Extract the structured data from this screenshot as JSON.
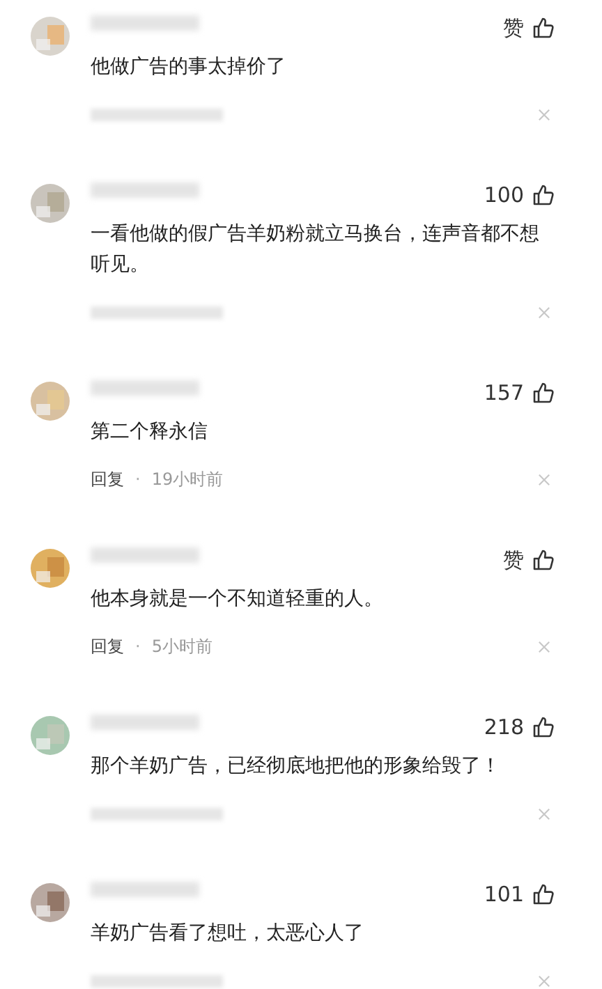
{
  "comments": [
    {
      "likes": "赞",
      "text": "他做广告的事太掉价了",
      "meta_hidden": true
    },
    {
      "likes": "100",
      "text": "一看他做的假广告羊奶粉就立马换台，连声音都不想听见。",
      "meta_hidden": true
    },
    {
      "likes": "157",
      "text": "第二个释永信",
      "meta_hidden": false,
      "reply": "回复",
      "separator": "·",
      "time": "19小时前"
    },
    {
      "likes": "赞",
      "text": "他本身就是一个不知道轻重的人。",
      "meta_hidden": false,
      "reply": "回复",
      "separator": "·",
      "time": "5小时前"
    },
    {
      "likes": "218",
      "text": "那个羊奶广告，已经彻底地把他的形象给毁了！",
      "meta_hidden": true
    },
    {
      "likes": "101",
      "text": "羊奶广告看了想吐，太恶心人了",
      "meta_hidden": true
    }
  ]
}
